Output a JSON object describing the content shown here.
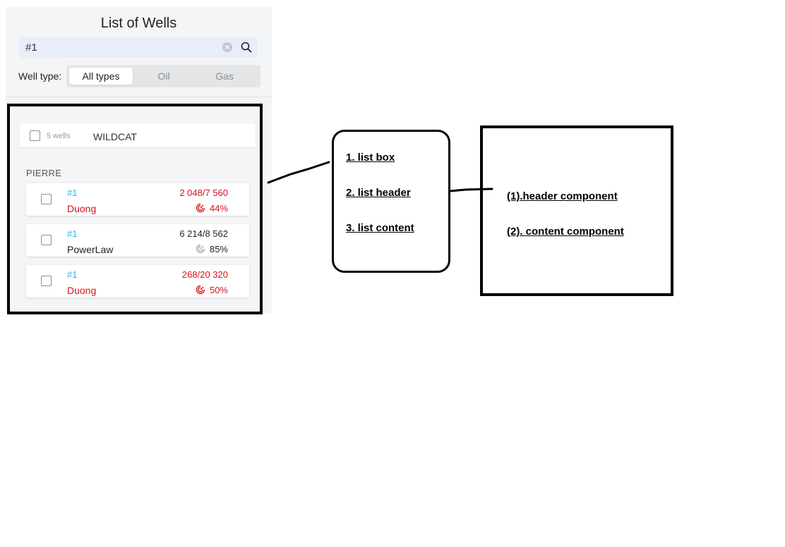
{
  "panel": {
    "title": "List of Wells",
    "search": {
      "value": "#1"
    },
    "well_type_label": "Well type:",
    "well_types": [
      "All types",
      "Oil",
      "Gas"
    ],
    "active_type": "All types"
  },
  "list": {
    "group": {
      "count_label": "5 wells",
      "name": "WILDCAT"
    },
    "section": "PIERRE",
    "wells": [
      {
        "id": "#1",
        "name": "Duong",
        "ratio": "2 048/7 560",
        "percent": "44%",
        "status": "red"
      },
      {
        "id": "#1",
        "name": "PowerLaw",
        "ratio": "6 214/8 562",
        "percent": "85%",
        "status": "gray"
      },
      {
        "id": "#1",
        "name": "Duong",
        "ratio": "268/20 320",
        "percent": "50%",
        "status": "red"
      }
    ]
  },
  "annotations": {
    "middle_box": [
      "1. list box",
      "2. list header",
      "3. list content"
    ],
    "right_box": [
      "(1).header component",
      "(2). content component"
    ]
  },
  "colors": {
    "accent_blue": "#2fb7e6",
    "alert_red": "#d7121c",
    "muted_gray": "#8a8f94"
  },
  "icons": {
    "clear": "clear-circle-icon",
    "search": "search-icon",
    "gauge": "gauge-icon"
  }
}
